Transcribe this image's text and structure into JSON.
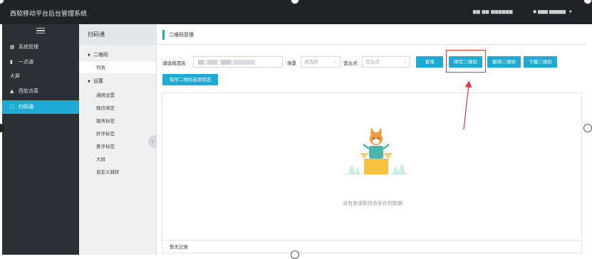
{
  "header": {
    "app_title": "西软移动平台后台管理系统",
    "tools_text": "▆▆ ▆▆ ▆▆▆▆▆▆",
    "user_text": "▆▆▆ ▆▆▆▆▆"
  },
  "sidebar": {
    "items": [
      {
        "label": "系统管理",
        "icon": "grid-icon"
      },
      {
        "label": "一点通",
        "icon": "bar-chart-icon"
      },
      {
        "label": "大屏",
        "icon": ""
      },
      {
        "label": "西软点菜",
        "icon": "cloud-icon"
      },
      {
        "label": "扫码通",
        "icon": "scan-icon"
      }
    ],
    "active_index": 4
  },
  "submenu": {
    "title": "扫码通",
    "groups": [
      {
        "label": "二维码",
        "items": [
          "列表"
        ]
      },
      {
        "label": "设置",
        "items": [
          "通用设置",
          "微信绑定",
          "服务标签",
          "好评标签",
          "差评标签",
          "大屏",
          "自定义跳转"
        ]
      }
    ]
  },
  "main": {
    "breadcrumb": "二维码管理",
    "store_label": "请选择酒店",
    "scene_label": "场景",
    "scene_placeholder": "请选择",
    "outlet_label": "营业点",
    "outlet_placeholder": "营业点",
    "buttons": {
      "query": "查询",
      "bind_qr": "绑定二维码",
      "unbind_qr": "解绑二维码",
      "download_qr": "下载二维码",
      "save_status": "保存二维码启用状态"
    },
    "empty_text": "没有查询到符合条件的数据",
    "footer_text": "暂无记录"
  },
  "colors": {
    "accent": "#1faad6",
    "header_bg": "#1f2327",
    "sidebar_bg": "#2b3036",
    "annotation": "#e3383a"
  }
}
